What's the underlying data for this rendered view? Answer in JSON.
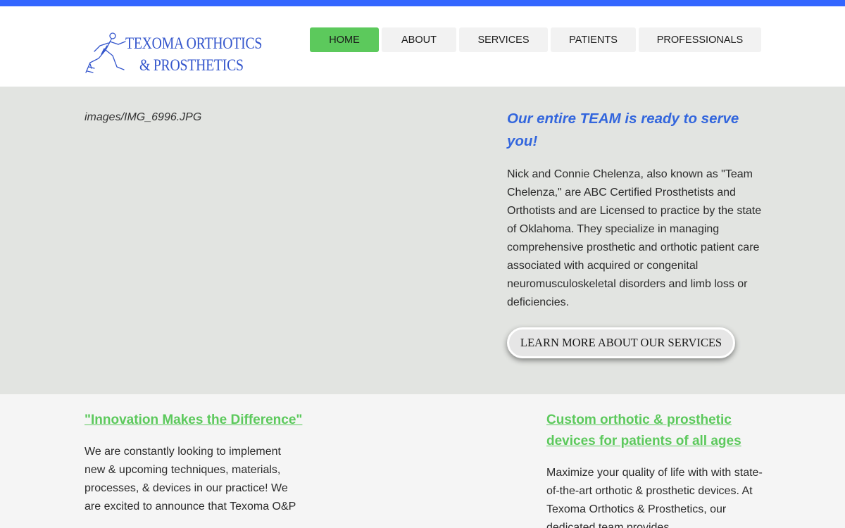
{
  "logo": {
    "line1": "TEXOMA ORTHOTICS",
    "line2": "& PROSTHETICS",
    "color": "#3355cc"
  },
  "nav": {
    "items": [
      {
        "label": "HOME",
        "active": true
      },
      {
        "label": "ABOUT",
        "active": false
      },
      {
        "label": "SERVICES",
        "active": false
      },
      {
        "label": "PATIENTS",
        "active": false
      },
      {
        "label": "PROFESSIONALS",
        "active": false
      }
    ],
    "active_color": "#5cc95c"
  },
  "hero": {
    "image_alt": "images/IMG_6996.JPG",
    "title": "Our entire TEAM is ready to serve you!",
    "body": "Nick and Connie Chelenza, also known as \"Team Chelenza,\" are ABC Certified Prosthetists and Orthotists and are Licensed to practice by the state of Oklahoma. They specialize in managing comprehensive prosthetic and orthotic patient care associated with acquired or congenital neuromusculoskeletal disorders and limb loss or deficiencies.",
    "button_label": "LEARN MORE ABOUT OUR SERVICES"
  },
  "features": {
    "left": {
      "title": "\"Innovation Makes the Difference\"",
      "body": "We are constantly looking to implement new & upcoming techniques, materials, processes, & devices in our practice! We are excited to announce that Texoma O&P"
    },
    "right": {
      "title": "Custom orthotic & prosthetic devices for patients of all ages",
      "body": "Maximize your quality of life with with state-of-the-art orthotic & prosthetic devices. At Texoma Orthotics & Prosthetics, our dedicated team provides"
    }
  },
  "colors": {
    "top_bar": "#3366ff",
    "accent_green": "#5cc95c",
    "title_blue": "#3366dd"
  }
}
